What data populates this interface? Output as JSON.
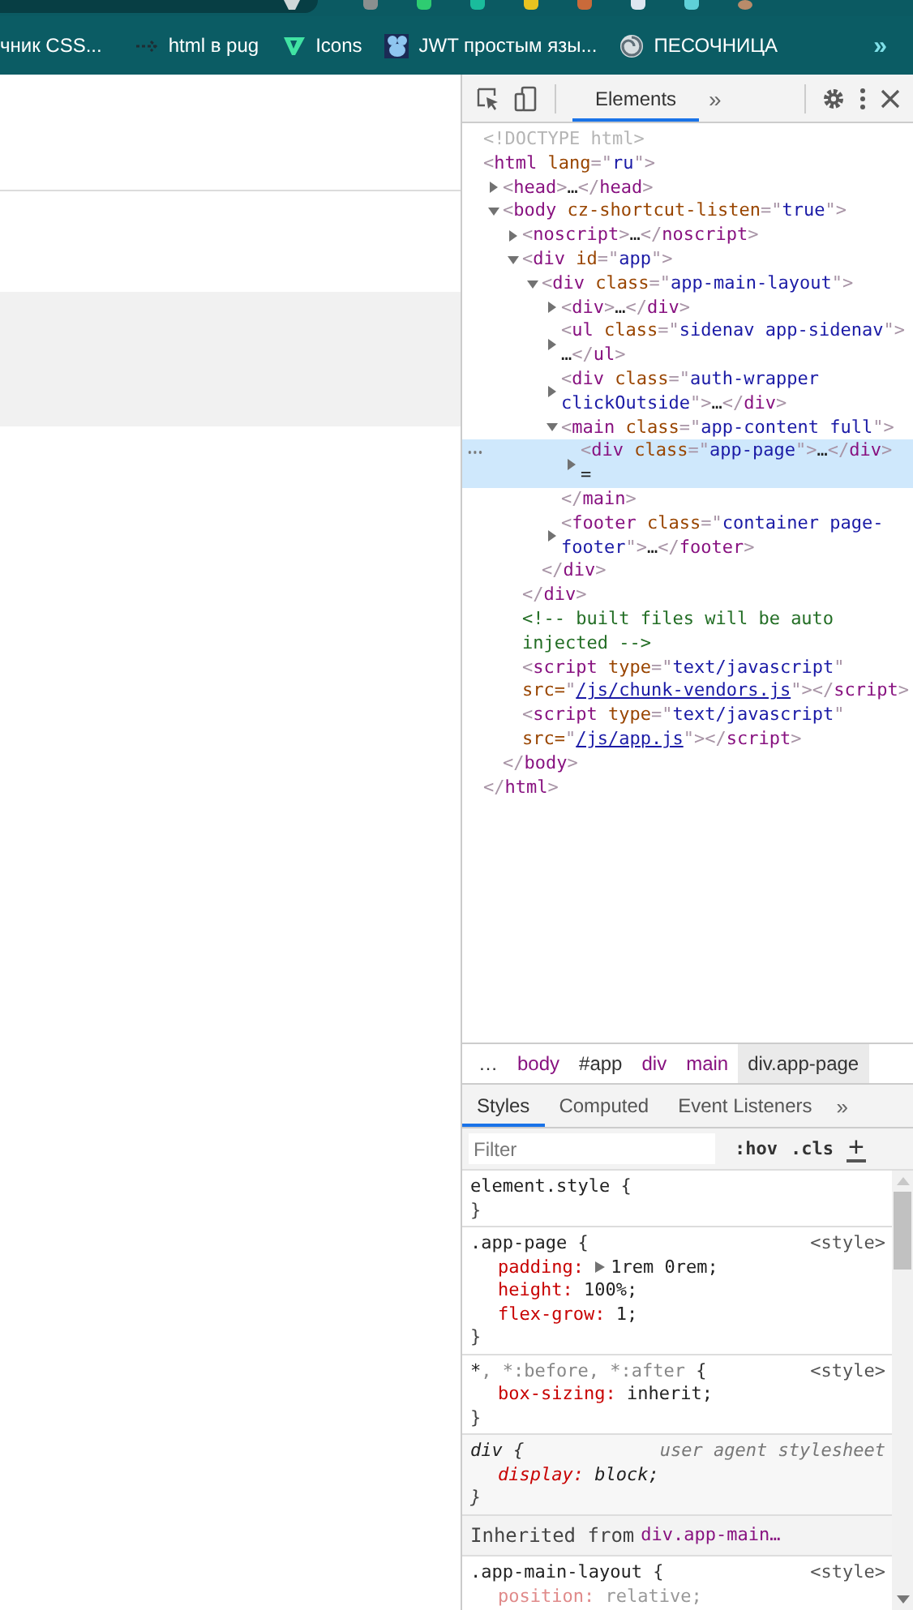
{
  "bookmarks": {
    "items": [
      {
        "label": "чник CSS..."
      },
      {
        "label": "html в pug",
        "kind": "arrows"
      },
      {
        "label": "Icons",
        "kind": "v-logo"
      },
      {
        "label": "JWT простым язы...",
        "kind": "mouse"
      },
      {
        "label": "ПЕСОЧНИЦА",
        "kind": "swirl"
      }
    ],
    "overflow": "»"
  },
  "devtools": {
    "tabs": [
      {
        "label": "Elements",
        "selected": true
      }
    ],
    "tabs_overflow": "»",
    "dom_tree": [
      {
        "tokens": [
          {
            "kind": "doctype",
            "text": "<!DOCTYPE html>"
          }
        ],
        "selected": false
      },
      {
        "tokens": [
          {
            "kind": "bracket",
            "text": "<"
          },
          {
            "kind": "tag",
            "text": "html"
          },
          {
            "kind": "attr",
            "text": " lang"
          },
          {
            "kind": "bracket",
            "text": "=\""
          },
          {
            "kind": "value",
            "text": "ru"
          },
          {
            "kind": "bracket",
            "text": "\">"
          }
        ],
        "selected": false,
        "close": [
          {
            "kind": "bracket",
            "text": "</"
          },
          {
            "kind": "tag",
            "text": "html"
          },
          {
            "kind": "bracket",
            "text": ">"
          }
        ],
        "children": [
          {
            "tokens": [
              {
                "kind": "bracket",
                "text": "<"
              },
              {
                "kind": "tag",
                "text": "head"
              },
              {
                "kind": "bracket",
                "text": ">"
              },
              {
                "kind": "text",
                "text": "…"
              },
              {
                "kind": "bracket",
                "text": "</"
              },
              {
                "kind": "tag",
                "text": "head"
              },
              {
                "kind": "bracket",
                "text": ">"
              }
            ],
            "expanded": false,
            "selected": false
          },
          {
            "tokens": [
              {
                "kind": "bracket",
                "text": "<"
              },
              {
                "kind": "tag",
                "text": "body"
              },
              {
                "kind": "attr",
                "text": " cz-shortcut-listen"
              },
              {
                "kind": "bracket",
                "text": "=\""
              },
              {
                "kind": "value",
                "text": "true"
              },
              {
                "kind": "bracket",
                "text": "\">"
              }
            ],
            "expanded": true,
            "selected": false,
            "close": [
              {
                "kind": "bracket",
                "text": "</"
              },
              {
                "kind": "tag",
                "text": "body"
              },
              {
                "kind": "bracket",
                "text": ">"
              }
            ],
            "children": [
              {
                "tokens": [
                  {
                    "kind": "bracket",
                    "text": "<"
                  },
                  {
                    "kind": "tag",
                    "text": "noscript"
                  },
                  {
                    "kind": "bracket",
                    "text": ">"
                  },
                  {
                    "kind": "text",
                    "text": "…"
                  },
                  {
                    "kind": "bracket",
                    "text": "</"
                  },
                  {
                    "kind": "tag",
                    "text": "noscript"
                  },
                  {
                    "kind": "bracket",
                    "text": ">"
                  }
                ],
                "expanded": false,
                "selected": false
              },
              {
                "tokens": [
                  {
                    "kind": "bracket",
                    "text": "<"
                  },
                  {
                    "kind": "tag",
                    "text": "div"
                  },
                  {
                    "kind": "attr",
                    "text": " id"
                  },
                  {
                    "kind": "bracket",
                    "text": "=\""
                  },
                  {
                    "kind": "value",
                    "text": "app"
                  },
                  {
                    "kind": "bracket",
                    "text": "\">"
                  }
                ],
                "expanded": true,
                "selected": false,
                "close": [
                  {
                    "kind": "bracket",
                    "text": "</"
                  },
                  {
                    "kind": "tag",
                    "text": "div"
                  },
                  {
                    "kind": "bracket",
                    "text": ">"
                  }
                ],
                "children": [
                  {
                    "tokens": [
                      {
                        "kind": "bracket",
                        "text": "<"
                      },
                      {
                        "kind": "tag",
                        "text": "div"
                      },
                      {
                        "kind": "attr",
                        "text": " class"
                      },
                      {
                        "kind": "bracket",
                        "text": "=\""
                      },
                      {
                        "kind": "value",
                        "text": "app-main-layout"
                      },
                      {
                        "kind": "bracket",
                        "text": "\">"
                      }
                    ],
                    "expanded": true,
                    "selected": false,
                    "close": [
                      {
                        "kind": "bracket",
                        "text": "</"
                      },
                      {
                        "kind": "tag",
                        "text": "div"
                      },
                      {
                        "kind": "bracket",
                        "text": ">"
                      }
                    ],
                    "children": [
                      {
                        "tokens": [
                          {
                            "kind": "bracket",
                            "text": "<"
                          },
                          {
                            "kind": "tag",
                            "text": "div"
                          },
                          {
                            "kind": "bracket",
                            "text": ">"
                          },
                          {
                            "kind": "text",
                            "text": "…"
                          },
                          {
                            "kind": "bracket",
                            "text": "</"
                          },
                          {
                            "kind": "tag",
                            "text": "div"
                          },
                          {
                            "kind": "bracket",
                            "text": ">"
                          }
                        ],
                        "expanded": false,
                        "selected": false
                      },
                      {
                        "tokens": [
                          {
                            "kind": "bracket",
                            "text": "<"
                          },
                          {
                            "kind": "tag",
                            "text": "ul"
                          },
                          {
                            "kind": "attr",
                            "text": " class"
                          },
                          {
                            "kind": "bracket",
                            "text": "=\""
                          },
                          {
                            "kind": "value",
                            "text": "sidenav app-sidenav"
                          },
                          {
                            "kind": "bracket",
                            "text": "\">"
                          },
                          {
                            "kind": "text",
                            "text": " …"
                          },
                          {
                            "kind": "bracket",
                            "text": "</"
                          },
                          {
                            "kind": "tag",
                            "text": "ul"
                          },
                          {
                            "kind": "bracket",
                            "text": ">"
                          }
                        ],
                        "expanded": false,
                        "selected": false
                      },
                      {
                        "tokens": [
                          {
                            "kind": "bracket",
                            "text": "<"
                          },
                          {
                            "kind": "tag",
                            "text": "div"
                          },
                          {
                            "kind": "attr",
                            "text": " class"
                          },
                          {
                            "kind": "bracket",
                            "text": "=\""
                          },
                          {
                            "kind": "value",
                            "text": "auth-wrapper clickOutside"
                          },
                          {
                            "kind": "bracket",
                            "text": "\">"
                          },
                          {
                            "kind": "text",
                            "text": "…"
                          },
                          {
                            "kind": "bracket",
                            "text": "</"
                          },
                          {
                            "kind": "tag",
                            "text": "div"
                          },
                          {
                            "kind": "bracket",
                            "text": ">"
                          }
                        ],
                        "expanded": false,
                        "selected": false
                      },
                      {
                        "tokens": [
                          {
                            "kind": "bracket",
                            "text": "<"
                          },
                          {
                            "kind": "tag",
                            "text": "main"
                          },
                          {
                            "kind": "attr",
                            "text": " class"
                          },
                          {
                            "kind": "bracket",
                            "text": "=\""
                          },
                          {
                            "kind": "value",
                            "text": "app-content full"
                          },
                          {
                            "kind": "bracket",
                            "text": "\">"
                          }
                        ],
                        "expanded": true,
                        "selected": false,
                        "close": [
                          {
                            "kind": "bracket",
                            "text": "</"
                          },
                          {
                            "kind": "tag",
                            "text": "main"
                          },
                          {
                            "kind": "bracket",
                            "text": ">"
                          }
                        ],
                        "children": [
                          {
                            "tokens": [
                              {
                                "kind": "bracket",
                                "text": "<"
                              },
                              {
                                "kind": "tag",
                                "text": "div"
                              },
                              {
                                "kind": "attr",
                                "text": " class"
                              },
                              {
                                "kind": "bracket",
                                "text": "=\""
                              },
                              {
                                "kind": "value",
                                "text": "app-page"
                              },
                              {
                                "kind": "bracket",
                                "text": "\">"
                              },
                              {
                                "kind": "text",
                                "text": "…"
                              },
                              {
                                "kind": "bracket",
                                "text": "</"
                              },
                              {
                                "kind": "tag",
                                "text": "div"
                              },
                              {
                                "kind": "bracket",
                                "text": ">"
                              },
                              {
                                "kind": "text",
                                "text": " ="
                              }
                            ],
                            "expanded": false,
                            "selected": true
                          }
                        ]
                      },
                      {
                        "tokens": [
                          {
                            "kind": "bracket",
                            "text": "<"
                          },
                          {
                            "kind": "tag",
                            "text": "footer"
                          },
                          {
                            "kind": "attr",
                            "text": " class"
                          },
                          {
                            "kind": "bracket",
                            "text": "=\""
                          },
                          {
                            "kind": "value",
                            "text": "container page-footer"
                          },
                          {
                            "kind": "bracket",
                            "text": "\">"
                          },
                          {
                            "kind": "text",
                            "text": "…"
                          },
                          {
                            "kind": "bracket",
                            "text": "</"
                          },
                          {
                            "kind": "tag",
                            "text": "footer"
                          },
                          {
                            "kind": "bracket",
                            "text": ">"
                          }
                        ],
                        "expanded": false,
                        "selected": false
                      }
                    ]
                  }
                ]
              },
              {
                "tokens": [
                  {
                    "kind": "comment",
                    "text": "<!-- built files will be auto injected -->"
                  }
                ],
                "selected": false
              },
              {
                "tokens": [
                  {
                    "kind": "bracket",
                    "text": "<"
                  },
                  {
                    "kind": "tag",
                    "text": "script"
                  },
                  {
                    "kind": "attr",
                    "text": " type"
                  },
                  {
                    "kind": "bracket",
                    "text": "=\""
                  },
                  {
                    "kind": "value",
                    "text": "text/javascript"
                  },
                  {
                    "kind": "bracket",
                    "text": "\""
                  },
                  {
                    "kind": "attr",
                    "text": " src="
                  },
                  {
                    "kind": "bracket",
                    "text": "\""
                  },
                  {
                    "kind": "link",
                    "text": "/js/chunk-vendors.js"
                  },
                  {
                    "kind": "bracket",
                    "text": "\">"
                  },
                  {
                    "kind": "bracket",
                    "text": "</"
                  },
                  {
                    "kind": "tag",
                    "text": "script"
                  },
                  {
                    "kind": "bracket",
                    "text": ">"
                  }
                ],
                "selected": false
              },
              {
                "tokens": [
                  {
                    "kind": "bracket",
                    "text": "<"
                  },
                  {
                    "kind": "tag",
                    "text": "script"
                  },
                  {
                    "kind": "attr",
                    "text": " type"
                  },
                  {
                    "kind": "bracket",
                    "text": "=\""
                  },
                  {
                    "kind": "value",
                    "text": "text/javascript"
                  },
                  {
                    "kind": "bracket",
                    "text": "\""
                  },
                  {
                    "kind": "attr",
                    "text": " src="
                  },
                  {
                    "kind": "bracket",
                    "text": "\""
                  },
                  {
                    "kind": "link",
                    "text": "/js/app.js"
                  },
                  {
                    "kind": "bracket",
                    "text": "\">"
                  },
                  {
                    "kind": "bracket",
                    "text": "</"
                  },
                  {
                    "kind": "tag",
                    "text": "script"
                  },
                  {
                    "kind": "bracket",
                    "text": ">"
                  }
                ],
                "selected": false
              }
            ]
          }
        ]
      }
    ],
    "breadcrumbs": [
      {
        "label": "…",
        "kind": "more",
        "selected": false
      },
      {
        "label": "body",
        "kind": "tag",
        "selected": false
      },
      {
        "label": "#app",
        "kind": "id",
        "selected": false
      },
      {
        "label": "div",
        "kind": "tag",
        "selected": false
      },
      {
        "label": "main",
        "kind": "tag",
        "selected": false
      },
      {
        "label": "div.app-page",
        "kind": "id",
        "selected": true
      }
    ],
    "pane_tabs": [
      {
        "label": "Styles",
        "selected": true
      },
      {
        "label": "Computed",
        "selected": false
      },
      {
        "label": "Event Listeners",
        "selected": false
      }
    ],
    "pane_tabs_overflow": "»",
    "filter": {
      "placeholder": "Filter",
      "hov": ":hov",
      "cls": ".cls",
      "add": "+"
    },
    "rules": [
      {
        "kind": "inline-rule",
        "selector": [
          {
            "text": "element.style",
            "matched": true
          }
        ],
        "open": " {",
        "close": "}"
      },
      {
        "kind": "author-rule",
        "source": "<style>",
        "selector": [
          {
            "text": ".app-page",
            "matched": true
          }
        ],
        "open": " {",
        "close": "}",
        "declarations": [
          {
            "name": "padding:",
            "value": "1rem 0rem;",
            "expandable": true,
            "inactive": false
          },
          {
            "name": "height:",
            "value": "100%;",
            "expandable": false,
            "inactive": false
          },
          {
            "name": "flex-grow:",
            "value": "1;",
            "expandable": false,
            "inactive": false
          }
        ]
      },
      {
        "kind": "author-rule",
        "source": "<style>",
        "selector": [
          {
            "text": "*",
            "matched": true
          },
          {
            "text": ", *:before, *:after",
            "matched": false
          }
        ],
        "open": " {",
        "close": "}",
        "declarations": [
          {
            "name": "box-sizing:",
            "value": "inherit;",
            "expandable": false,
            "inactive": false
          }
        ]
      },
      {
        "kind": "ua-rule",
        "source": "user agent stylesheet",
        "selector": [
          {
            "text": "div",
            "matched": true
          }
        ],
        "open": " {",
        "close": "}",
        "declarations": [
          {
            "name": "display:",
            "value": "block;",
            "expandable": false,
            "inactive": false
          }
        ]
      },
      {
        "kind": "inherited",
        "label": "Inherited from",
        "element": "div.app-main…"
      },
      {
        "kind": "author-rule",
        "source": "<style>",
        "selector": [
          {
            "text": ".app-main-layout",
            "matched": true
          }
        ],
        "open": " {",
        "declarations": [
          {
            "name": "position:",
            "value": "relative;",
            "expandable": false,
            "inactive": true
          }
        ]
      }
    ]
  }
}
